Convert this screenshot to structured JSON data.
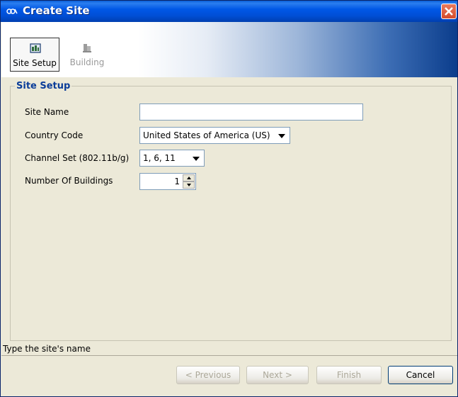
{
  "window": {
    "title": "Create Site"
  },
  "toolbar": {
    "items": [
      {
        "label": "Site Setup",
        "selected": true
      },
      {
        "label": "Building",
        "selected": false
      }
    ]
  },
  "panel": {
    "title": "Site Setup",
    "fields": {
      "site_name": {
        "label": "Site Name",
        "value": ""
      },
      "country_code": {
        "label": "Country Code",
        "value": "United States of America (US)"
      },
      "channel_set": {
        "label": "Channel Set (802.11b/g)",
        "value": "1, 6, 11"
      },
      "buildings": {
        "label": "Number Of Buildings",
        "value": "1"
      }
    }
  },
  "status": {
    "text": "Type the site's name"
  },
  "buttons": {
    "previous": "< Previous",
    "next": "Next >",
    "finish": "Finish",
    "cancel": "Cancel"
  },
  "colors": {
    "title_bar": "#0058e6",
    "panel_title": "#0b3d99",
    "close": "#d54d2c"
  }
}
